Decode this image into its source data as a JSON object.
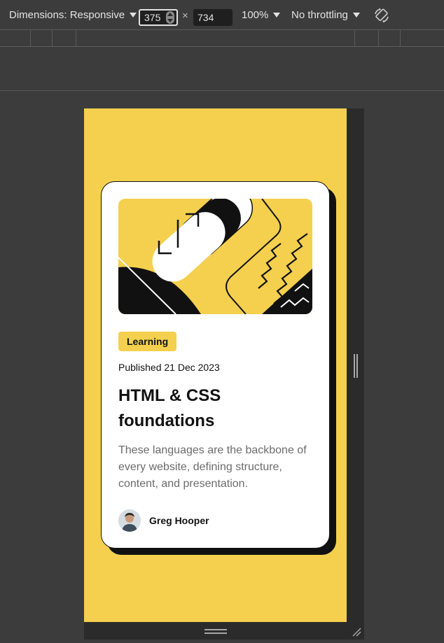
{
  "toolbar": {
    "dimensions_label": "Dimensions: Responsive",
    "width_value": "375",
    "times_sign": "×",
    "height_value": "734",
    "zoom": "100%",
    "throttling": "No throttling",
    "rotate_icon": "rotate-icon"
  },
  "card": {
    "tag": "Learning",
    "published": "Published 21 Dec 2023",
    "title": "HTML & CSS foundations",
    "description": "These languages are the backbone of every website, defining structure, content, and presentation.",
    "author": "Greg Hooper"
  },
  "colors": {
    "accent": "#f4d04e",
    "ink": "#111111",
    "devtools_bg": "#3c3c3c"
  }
}
